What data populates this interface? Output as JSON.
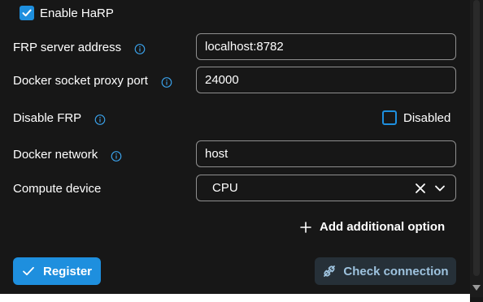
{
  "harp": {
    "label": "Enable HaRP",
    "checked": true
  },
  "fields": {
    "frp_server_address": {
      "label": "FRP server address",
      "value": "localhost:8782"
    },
    "docker_socket_proxy_port": {
      "label": "Docker socket proxy port",
      "value": "24000"
    },
    "disable_frp": {
      "label": "Disable FRP",
      "checkbox_label": "Disabled",
      "checked": false
    },
    "docker_network": {
      "label": "Docker network",
      "value": "host"
    },
    "compute_device": {
      "label": "Compute device",
      "value": "CPU"
    }
  },
  "actions": {
    "add_option": "Add additional option",
    "register": "Register",
    "check_connection": "Check connection"
  },
  "colors": {
    "accent": "#1e8fde",
    "background": "#171717",
    "secondary_button_bg": "#263038",
    "secondary_button_text": "#9ec3df"
  },
  "icons": {
    "info": "info-circle-icon",
    "clear": "close-icon",
    "dropdown": "chevron-down-icon",
    "add": "plus-icon",
    "register": "checkmark-icon",
    "check_connection": "plug-icon"
  }
}
